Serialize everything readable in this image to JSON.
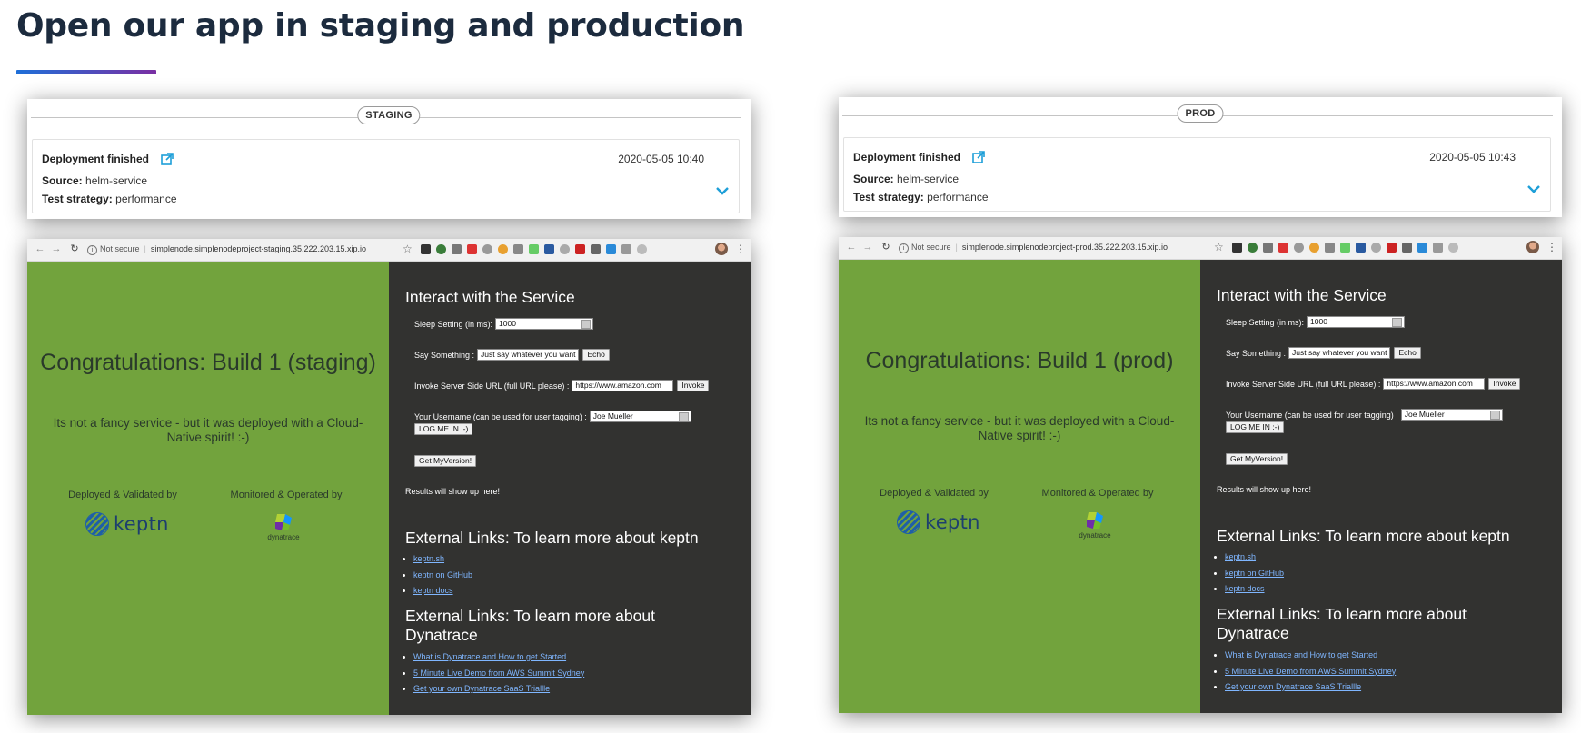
{
  "slide": {
    "title": "Open our app in staging and production"
  },
  "panels": [
    {
      "id": "staging",
      "stage_label": "STAGING",
      "event": {
        "title": "Deployment finished",
        "date": "2020-05-05 10:40",
        "source_label": "Source:",
        "source": "helm-service",
        "strategy_label": "Test strategy:",
        "strategy": "performance"
      },
      "browser": {
        "not_secure": "Not secure",
        "url": "simplenode.simplenodeproject-staging.35.222.203.15.xip.io"
      },
      "app": {
        "congrats": "Congratulations: Build 1 (staging)",
        "tagline": "Its not a fancy service - but it was deployed with a Cloud-Native spirit! :-)",
        "deployed_by": "Deployed & Validated by",
        "monitored_by": "Monitored & Operated by",
        "keptn_word": "keptn",
        "dynatrace_word": "dynatrace",
        "interact_title": "Interact with the Service",
        "sleep_label": "Sleep Setting (in ms):",
        "sleep_value": "1000",
        "say_label": "Say Something :",
        "say_value": "Just say whatever you want",
        "echo_btn": "Echo",
        "invoke_label": "Invoke Server Side URL (full URL please) :",
        "invoke_value": "https://www.amazon.com",
        "invoke_btn": "Invoke",
        "username_label": "Your Username (can be used for user tagging) :",
        "username_value": "Joe Mueller",
        "login_btn": "LOG ME IN :-)",
        "version_btn": "Get MyVersion!",
        "results": "Results will show up here!",
        "keptn_links_title": "External Links: To learn more about keptn",
        "keptn_links": [
          "keptn.sh",
          "keptn on GitHub",
          "keptn docs"
        ],
        "dt_links_title": "External Links: To learn more about Dynatrace",
        "dt_links": [
          "What is Dynatrace and How to get Started",
          "5 Minute Live Demo from AWS Summit Sydney",
          "Get your own Dynatrace SaaS Triallle"
        ]
      }
    },
    {
      "id": "prod",
      "stage_label": "PROD",
      "event": {
        "title": "Deployment finished",
        "date": "2020-05-05 10:43",
        "source_label": "Source:",
        "source": "helm-service",
        "strategy_label": "Test strategy:",
        "strategy": "performance"
      },
      "browser": {
        "not_secure": "Not secure",
        "url": "simplenode.simplenodeproject-prod.35.222.203.15.xip.io"
      },
      "app": {
        "congrats": "Congratulations: Build 1 (prod)",
        "tagline": "Its not a fancy service - but it was deployed with a Cloud-Native spirit! :-)",
        "deployed_by": "Deployed & Validated by",
        "monitored_by": "Monitored & Operated by",
        "keptn_word": "keptn",
        "dynatrace_word": "dynatrace",
        "interact_title": "Interact with the Service",
        "sleep_label": "Sleep Setting (in ms):",
        "sleep_value": "1000",
        "say_label": "Say Something :",
        "say_value": "Just say whatever you want",
        "echo_btn": "Echo",
        "invoke_label": "Invoke Server Side URL (full URL please) :",
        "invoke_value": "https://www.amazon.com",
        "invoke_btn": "Invoke",
        "username_label": "Your Username (can be used for user tagging) :",
        "username_value": "Joe Mueller",
        "login_btn": "LOG ME IN :-)",
        "version_btn": "Get MyVersion!",
        "results": "Results will show up here!",
        "keptn_links_title": "External Links: To learn more about keptn",
        "keptn_links": [
          "keptn.sh",
          "keptn on GitHub",
          "keptn docs"
        ],
        "dt_links_title": "External Links: To learn more about Dynatrace",
        "dt_links": [
          "What is Dynatrace and How to get Started",
          "5 Minute Live Demo from AWS Summit Sydney",
          "Get your own Dynatrace SaaS Triallle"
        ]
      }
    }
  ],
  "colors": {
    "app_green": "#72a33d",
    "app_dark": "#323230",
    "link": "#7fb6ff",
    "keptn_blue": "#1d3f6e",
    "accent_teal": "#1e9fd8"
  }
}
